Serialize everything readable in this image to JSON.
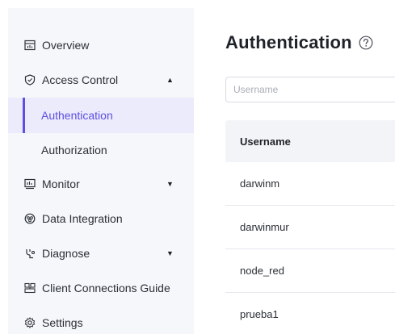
{
  "sidebar": {
    "items": [
      {
        "label": "Overview",
        "icon": "dashboard-icon"
      },
      {
        "label": "Access Control",
        "icon": "shield-icon",
        "caret": "▲"
      },
      {
        "label": "Authentication",
        "active": true
      },
      {
        "label": "Authorization"
      },
      {
        "label": "Monitor",
        "icon": "monitor-icon",
        "caret": "▼"
      },
      {
        "label": "Data Integration",
        "icon": "integration-icon"
      },
      {
        "label": "Diagnose",
        "icon": "diagnose-icon",
        "caret": "▼"
      },
      {
        "label": "Client Connections Guide",
        "icon": "connections-guide-icon"
      },
      {
        "label": "Settings",
        "icon": "gear-icon"
      }
    ]
  },
  "main": {
    "title": "Authentication",
    "help_icon": "help-circle-icon",
    "search": {
      "placeholder": "Username",
      "value": ""
    },
    "table": {
      "columns": [
        "Username"
      ],
      "rows": [
        "darwinm",
        "darwinmur",
        "node_red",
        "prueba1"
      ]
    }
  },
  "colors": {
    "accent": "#5d4fe0",
    "active_bg": "#ecebfc",
    "sidebar_bg": "#f6f7fb",
    "header_bg": "#f3f4f7"
  }
}
